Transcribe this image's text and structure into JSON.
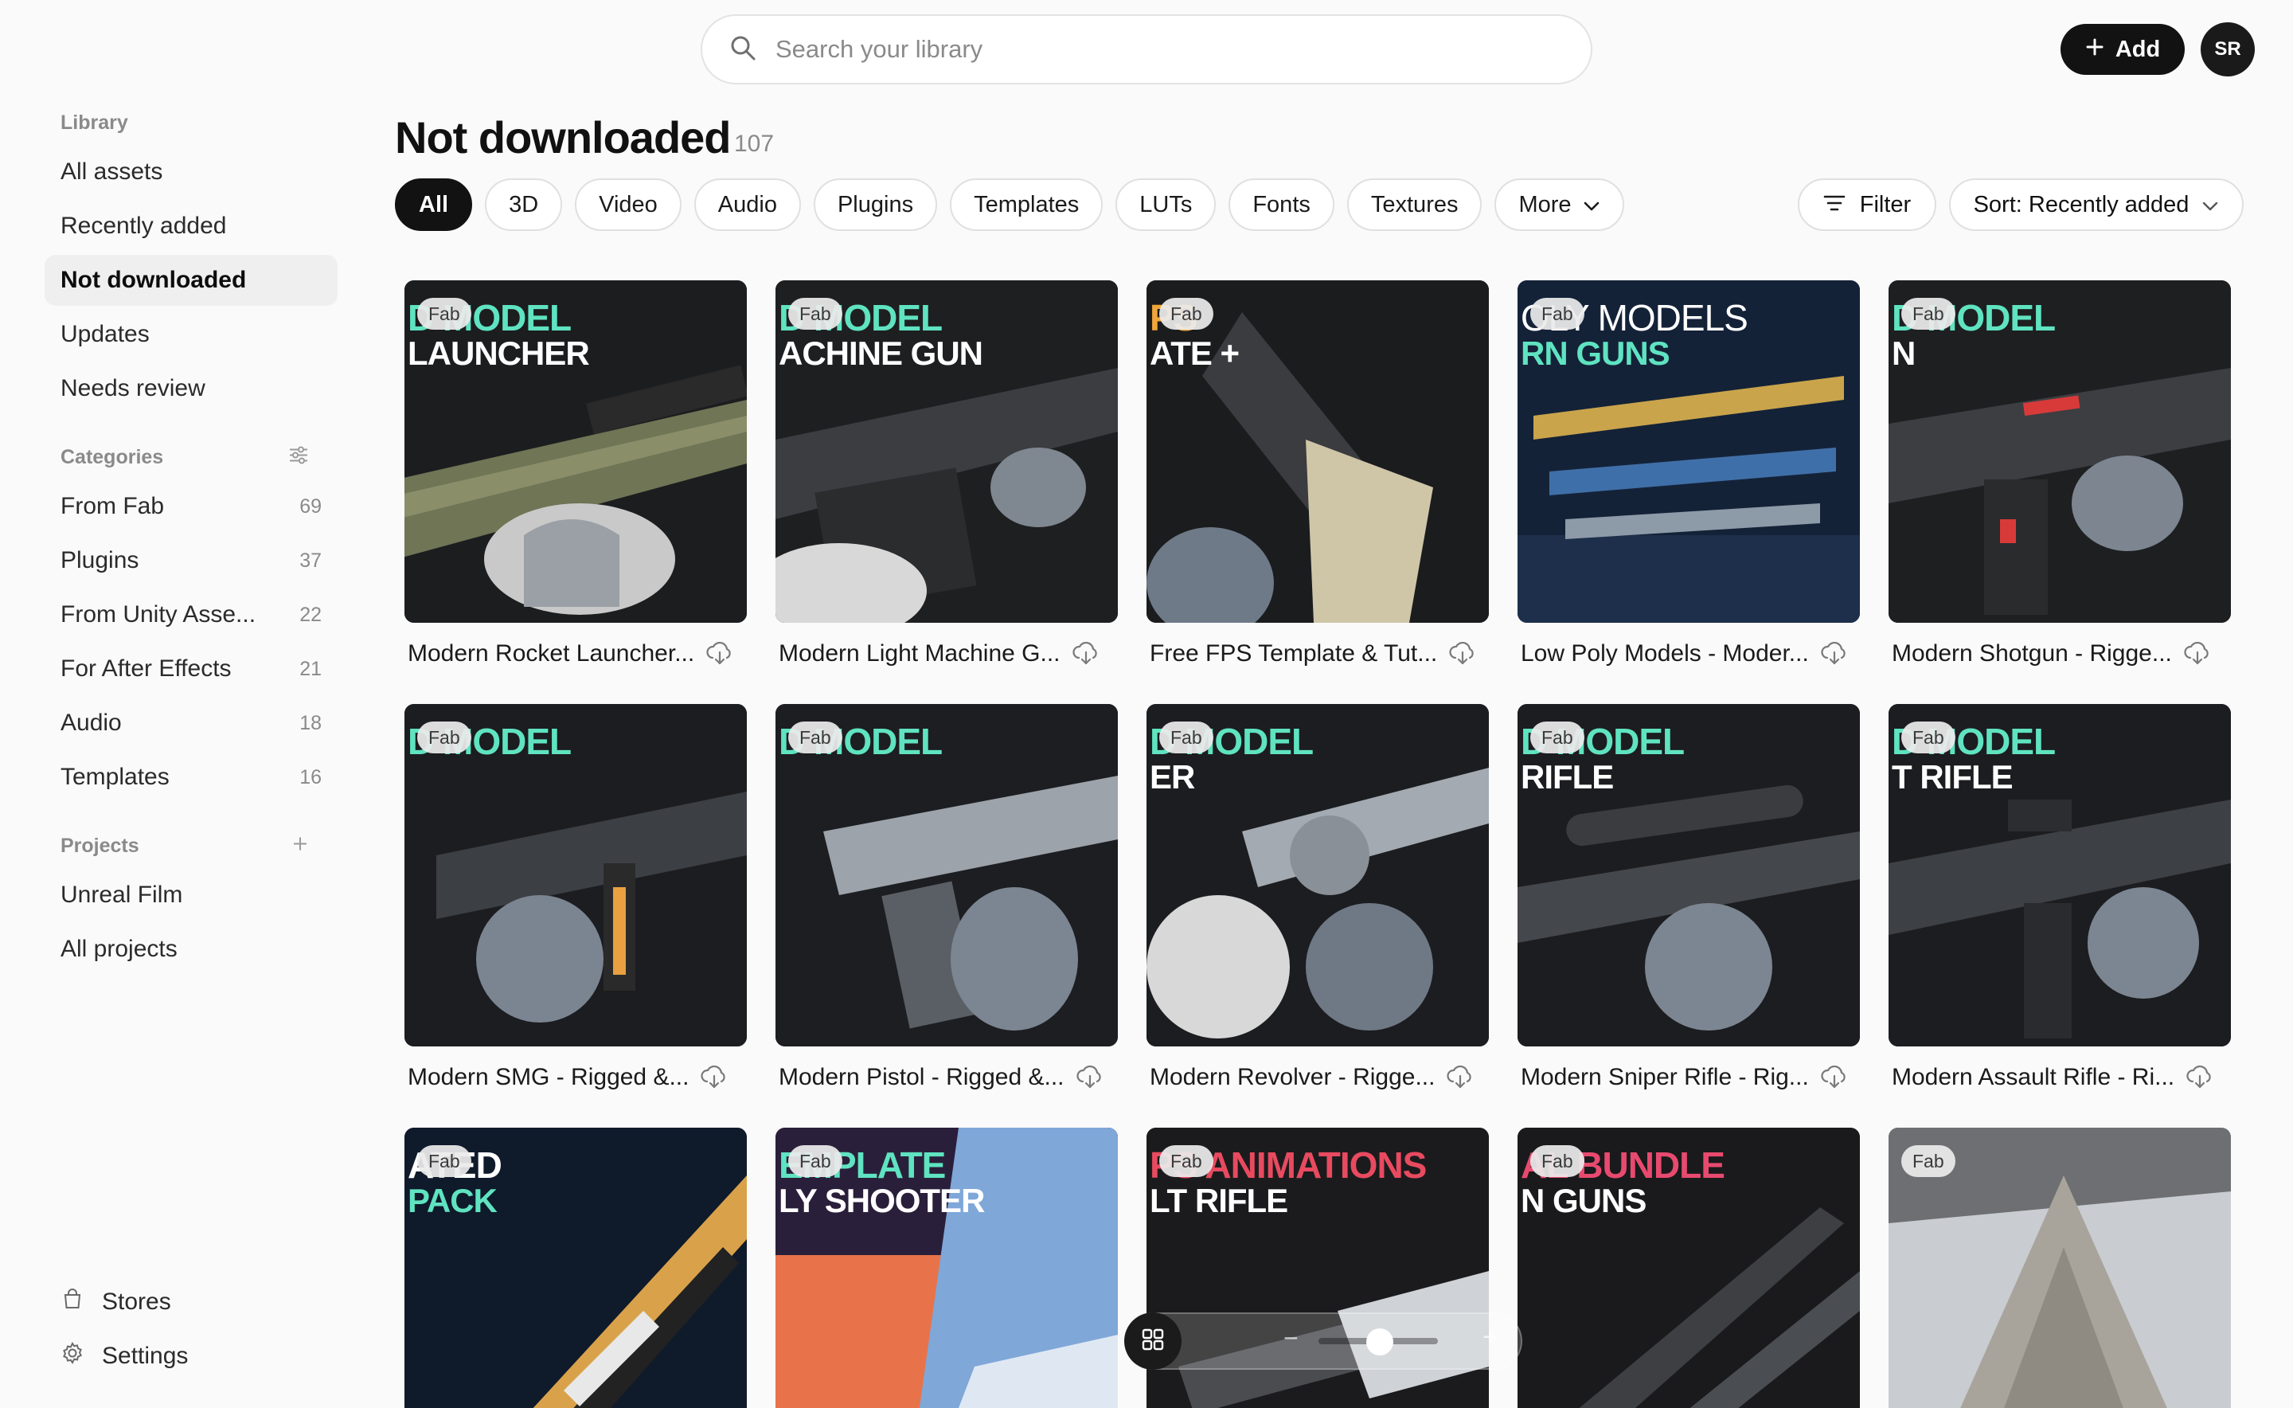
{
  "search": {
    "placeholder": "Search your library",
    "icon": "search-icon"
  },
  "topbar": {
    "add_label": "Add",
    "avatar_initials": "SR"
  },
  "sidebar": {
    "library_heading": "Library",
    "library_items": [
      {
        "label": "All assets"
      },
      {
        "label": "Recently added"
      },
      {
        "label": "Not downloaded",
        "active": true
      },
      {
        "label": "Updates"
      },
      {
        "label": "Needs review"
      }
    ],
    "categories_heading": "Categories",
    "categories": [
      {
        "label": "From Fab",
        "count": "69"
      },
      {
        "label": "Plugins",
        "count": "37"
      },
      {
        "label": "From Unity Asse...",
        "count": "22"
      },
      {
        "label": "For After Effects",
        "count": "21"
      },
      {
        "label": "Audio",
        "count": "18"
      },
      {
        "label": "Templates",
        "count": "16"
      }
    ],
    "projects_heading": "Projects",
    "projects": [
      {
        "label": "Unreal Film"
      },
      {
        "label": "All projects"
      }
    ],
    "bottom": [
      {
        "label": "Stores",
        "icon": "store-icon"
      },
      {
        "label": "Settings",
        "icon": "gear-icon"
      }
    ]
  },
  "header": {
    "title": "Not downloaded",
    "count": "107"
  },
  "filters": {
    "chips": [
      "All",
      "3D",
      "Video",
      "Audio",
      "Plugins",
      "Templates",
      "LUTs",
      "Fonts",
      "Textures",
      "More"
    ],
    "active_chip": "All",
    "filter_label": "Filter",
    "sort_label": "Sort: Recently added"
  },
  "grid": {
    "badge": "Fab",
    "cards": [
      {
        "title": "Modern Rocket Launcher...",
        "banner1": "D MODEL",
        "banner2": "LAUNCHER",
        "accent": "#5fe3c0"
      },
      {
        "title": "Modern Light Machine G...",
        "banner1": "D MODEL",
        "banner2": "ACHINE GUN",
        "accent": "#5fe3c0"
      },
      {
        "title": "Free FPS Template & Tut...",
        "banner1": "PS",
        "banner2": "ATE +",
        "accent": "#f0a63a"
      },
      {
        "title": "Low Poly Models - Moder...",
        "banner1": "OLY MODELS",
        "banner2": "RN GUNS",
        "accent": "#ffffff"
      },
      {
        "title": "Modern Shotgun - Rigge...",
        "banner1": "D MODEL",
        "banner2": "N",
        "accent": "#5fe3c0"
      },
      {
        "title": "Modern SMG - Rigged &...",
        "banner1": "D MODEL",
        "banner2": "",
        "accent": "#5fe3c0"
      },
      {
        "title": "Modern Pistol - Rigged &...",
        "banner1": "D MODEL",
        "banner2": "",
        "accent": "#5fe3c0"
      },
      {
        "title": "Modern Revolver - Rigge...",
        "banner1": "D MODEL",
        "banner2": "ER",
        "accent": "#5fe3c0"
      },
      {
        "title": "Modern Sniper Rifle - Rig...",
        "banner1": "D MODEL",
        "banner2": "RIFLE",
        "accent": "#5fe3c0"
      },
      {
        "title": "Modern Assault Rifle - Ri...",
        "banner1": "D MODEL",
        "banner2": "T RIFLE",
        "accent": "#5fe3c0"
      },
      {
        "title": "",
        "banner1": "ATED",
        "banner2": "PACK",
        "accent": "#5fe3c0"
      },
      {
        "title": "",
        "banner1": "EMPLATE",
        "banner2": "LY SHOOTER",
        "accent": "#5fe3c0"
      },
      {
        "title": "",
        "banner1": "PS ANIMATIONS",
        "banner2": "LT RIFLE",
        "accent": "#e84a5f"
      },
      {
        "title": "",
        "banner1": "AL BUNDLE",
        "banner2": "N GUNS",
        "accent": "#e84a6f"
      },
      {
        "title": "",
        "banner1": "",
        "banner2": "",
        "accent": "#ffffff"
      }
    ]
  },
  "view_toolbar": {
    "icon": "grid-view-icon",
    "minus": "−",
    "plus": "+"
  }
}
